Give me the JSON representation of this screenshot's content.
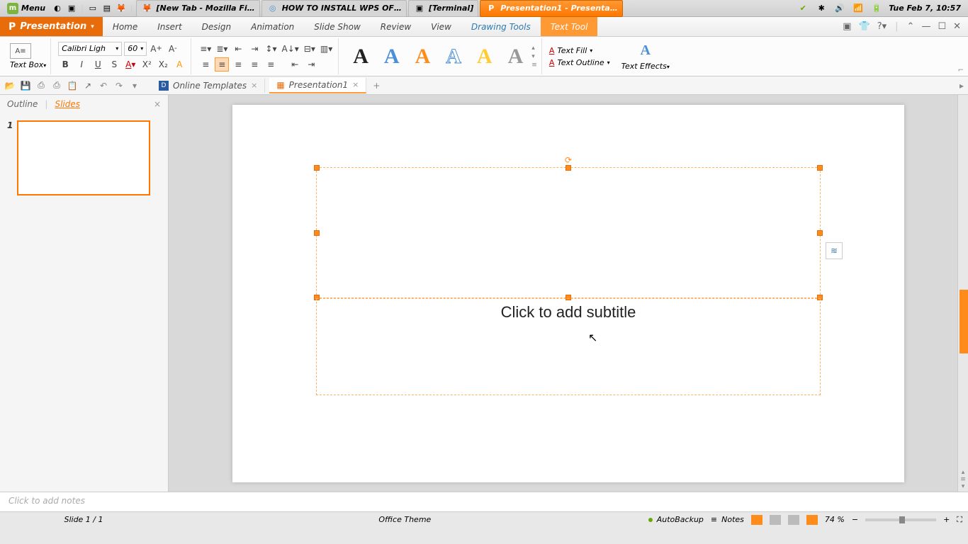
{
  "system": {
    "menu": "Menu",
    "tasks": [
      {
        "label": "[New Tab - Mozilla Fi…",
        "icon": "firefox"
      },
      {
        "label": "HOW TO INSTALL WPS OF…",
        "icon": "chromium"
      },
      {
        "label": "[Terminal]",
        "icon": "terminal"
      },
      {
        "label": "Presentation1 - Presenta…",
        "icon": "wps",
        "active": true
      }
    ],
    "clock": "Tue Feb  7, 10:57"
  },
  "app": {
    "brand": "Presentation",
    "menu_tabs": [
      "Home",
      "Insert",
      "Design",
      "Animation",
      "Slide Show",
      "Review",
      "View",
      "Drawing Tools",
      "Text Tool"
    ],
    "active_tab": "Text Tool",
    "context_tabs": [
      "Drawing Tools",
      "Text Tool"
    ]
  },
  "ribbon": {
    "text_box_label": "Text Box",
    "font_name": "Calibri Ligh",
    "font_size": "60",
    "text_fill": "Text Fill",
    "text_outline": "Text Outline",
    "text_effects": "Text Effects"
  },
  "doc_tabs": {
    "templates": "Online Templates",
    "current": "Presentation1"
  },
  "side": {
    "outline": "Outline",
    "slides": "Slides",
    "thumb_num": "1"
  },
  "slide": {
    "subtitle_placeholder": "Click to add subtitle"
  },
  "notes": {
    "placeholder": "Click to add notes"
  },
  "status": {
    "slide_counter": "Slide 1 / 1",
    "theme": "Office Theme",
    "autobackup": "AutoBackup",
    "notes": "Notes",
    "zoom": "74 %"
  }
}
